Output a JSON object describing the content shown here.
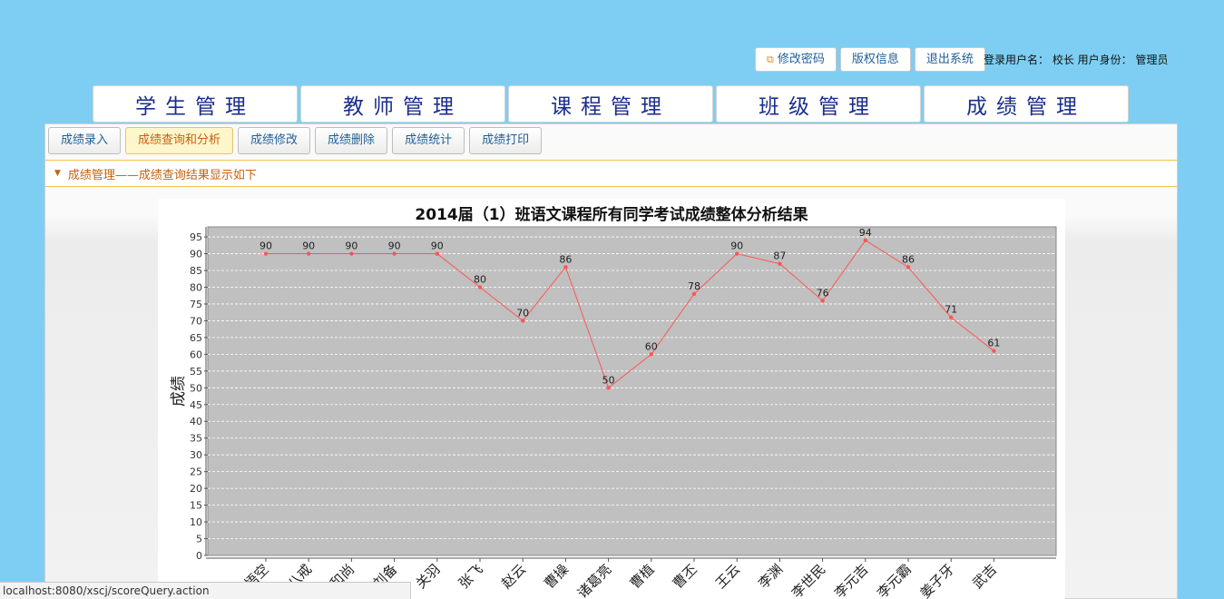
{
  "top_buttons": {
    "change_password": "修改密码",
    "copyright": "版权信息",
    "logout": "退出系统"
  },
  "user_info": "登录用户名： 校长 用户身份： 管理员",
  "main_tabs": [
    {
      "label": "学生管理"
    },
    {
      "label": "教师管理"
    },
    {
      "label": "课程管理"
    },
    {
      "label": "班级管理"
    },
    {
      "label": "成绩管理"
    }
  ],
  "sub_tabs": [
    {
      "label": "成绩录入"
    },
    {
      "label": "成绩查询和分析",
      "active": true
    },
    {
      "label": "成绩修改"
    },
    {
      "label": "成绩删除"
    },
    {
      "label": "成绩统计"
    },
    {
      "label": "成绩打印"
    }
  ],
  "section_title": "成绩管理——成绩查询结果显示如下",
  "status_url": "localhost:8080/xscj/scoreQuery.action",
  "colors": {
    "background": "#7ecef3",
    "tab_text": "#1c2e8c",
    "active_orange": "#c4610d",
    "plot_bg": "#c0c0c0",
    "line": "#ff5555"
  },
  "chart_data": {
    "type": "line",
    "title": "2014届（1）班语文课程所有同学考试成绩整体分析结果",
    "ylabel": "成绩",
    "xlabel": "",
    "ylim": [
      0,
      98
    ],
    "yticks": [
      0,
      5,
      10,
      15,
      20,
      25,
      30,
      35,
      40,
      45,
      50,
      55,
      60,
      65,
      70,
      75,
      80,
      85,
      90,
      95
    ],
    "grid": true,
    "categories": [
      "孙悟空",
      "猪八戒",
      "沙和尚",
      "刘备",
      "关羽",
      "张飞",
      "赵云",
      "曹操",
      "诸葛亮",
      "曹植",
      "曹丕",
      "王云",
      "李渊",
      "李世民",
      "李元吉",
      "李元霸",
      "姜子牙",
      "武吉"
    ],
    "values": [
      90,
      90,
      90,
      90,
      90,
      80,
      70,
      86,
      50,
      60,
      78,
      90,
      87,
      76,
      94,
      86,
      71,
      61
    ]
  }
}
